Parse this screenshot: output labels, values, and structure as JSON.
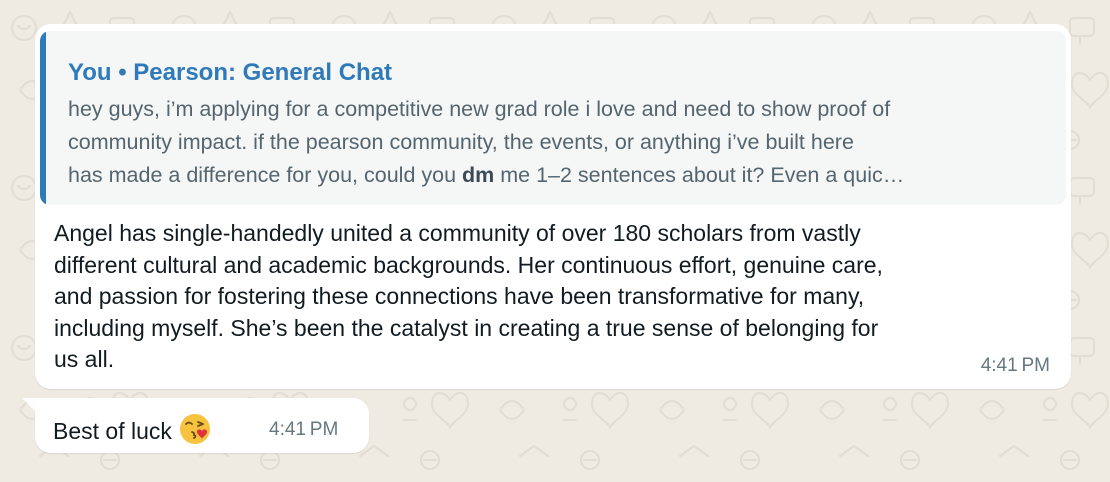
{
  "colors": {
    "wallpaper": "#efeae2",
    "bubble": "#ffffff",
    "quote_background": "#f5f6f6",
    "quote_accent": "#2f7ab8",
    "text": "#111b21",
    "timestamp": "#667781"
  },
  "messages": [
    {
      "quoted": {
        "sender": "You • Pearson: General Chat",
        "lines": [
          {
            "text": "hey guys, i’m applying for a competitive new grad role i love and need to show proof of"
          },
          {
            "text": "community impact. if the pearson community, the events, or anything i’ve built here"
          },
          {
            "before": "has made a difference for you, could you ",
            "bold": "dm",
            "after": " me 1–2 sentences about it? Even a quic…"
          }
        ]
      },
      "lines": [
        "Angel has single-handedly united a community of over 180 scholars from vastly",
        "different cultural and academic backgrounds. Her continuous effort, genuine care,",
        "and passion for fostering these connections have been transformative for many,",
        "including myself. She’s been the catalyst in creating a true sense of belonging for",
        "us all."
      ],
      "time": "4:41 PM"
    },
    {
      "text": "Best of luck",
      "emoji": "face-blowing-a-kiss-icon",
      "time": "4:41 PM"
    }
  ]
}
